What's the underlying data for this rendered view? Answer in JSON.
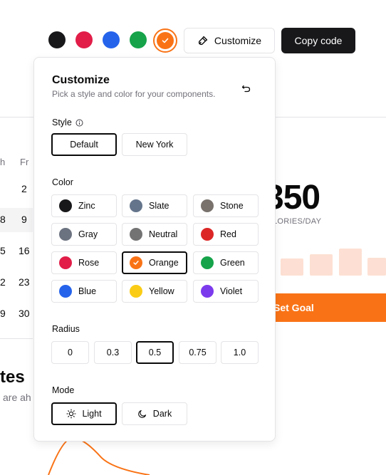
{
  "toolbar": {
    "swatches": [
      {
        "name": "zinc",
        "color": "#18181b"
      },
      {
        "name": "rose",
        "color": "#e11d48"
      },
      {
        "name": "blue",
        "color": "#2563eb"
      },
      {
        "name": "green",
        "color": "#16a34a"
      },
      {
        "name": "orange",
        "color": "#f97316",
        "active": true
      }
    ],
    "customize_label": "Customize",
    "copy_label": "Copy code"
  },
  "popover": {
    "title": "Customize",
    "subtitle": "Pick a style and color for your components.",
    "style": {
      "label": "Style",
      "options": [
        "Default",
        "New York"
      ],
      "selected": "Default"
    },
    "color": {
      "label": "Color",
      "options": [
        {
          "label": "Zinc",
          "color": "#18181b"
        },
        {
          "label": "Slate",
          "color": "#64748b"
        },
        {
          "label": "Stone",
          "color": "#78716c"
        },
        {
          "label": "Gray",
          "color": "#6b7280"
        },
        {
          "label": "Neutral",
          "color": "#737373"
        },
        {
          "label": "Red",
          "color": "#dc2626"
        },
        {
          "label": "Rose",
          "color": "#e11d48"
        },
        {
          "label": "Orange",
          "color": "#f97316"
        },
        {
          "label": "Green",
          "color": "#16a34a"
        },
        {
          "label": "Blue",
          "color": "#2563eb"
        },
        {
          "label": "Yellow",
          "color": "#facc15"
        },
        {
          "label": "Violet",
          "color": "#7c3aed"
        }
      ],
      "selected": "Orange"
    },
    "radius": {
      "label": "Radius",
      "options": [
        "0",
        "0.3",
        "0.5",
        "0.75",
        "1.0"
      ],
      "selected": "0.5"
    },
    "mode": {
      "label": "Mode",
      "options": [
        "Light",
        "Dark"
      ],
      "selected": "Light"
    }
  },
  "background": {
    "calendar": {
      "head_th": "h",
      "head_fr": "Fr",
      "rows": [
        [
          "",
          "2"
        ],
        [
          "8",
          "9"
        ],
        [
          "5",
          "16"
        ],
        [
          "2",
          "23"
        ],
        [
          "9",
          "30"
        ]
      ]
    },
    "goal": {
      "value": "350",
      "unit": "LORIES/DAY",
      "button": "Set Goal"
    },
    "section_title": "tes",
    "section_sub": "are ah"
  },
  "colors": {
    "accent": "#f97316",
    "border": "#e4e4e7",
    "muted": "#71717a"
  }
}
